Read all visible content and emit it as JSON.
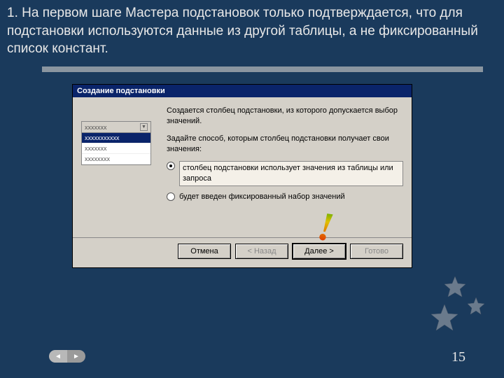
{
  "caption": "1. На первом шаге Мастера подстановок только подтверждается, что для подстановки используются данные из другой таблицы, а не фиксированный список констант.",
  "dialog": {
    "title": "Создание подстановки",
    "intro1": "Создается столбец подстановки, из которого допускается выбор значений.",
    "intro2": "Задайте способ, которым столбец подстановки получает свои значения:",
    "option1": "столбец подстановки использует значения из таблицы или запроса",
    "option2": "будет введен фиксированный набор значений",
    "illustration": {
      "head": "xxxxxxx",
      "rows": [
        "xxxxxxxxxxx",
        "xxxxxxx",
        "xxxxxxxx"
      ]
    },
    "buttons": {
      "cancel": "Отмена",
      "back": "< Назад",
      "next": "Далее >",
      "finish": "Готово"
    }
  },
  "exclaim": "!",
  "page_number": "15",
  "pager": {
    "prev": "◄",
    "next": "►"
  }
}
